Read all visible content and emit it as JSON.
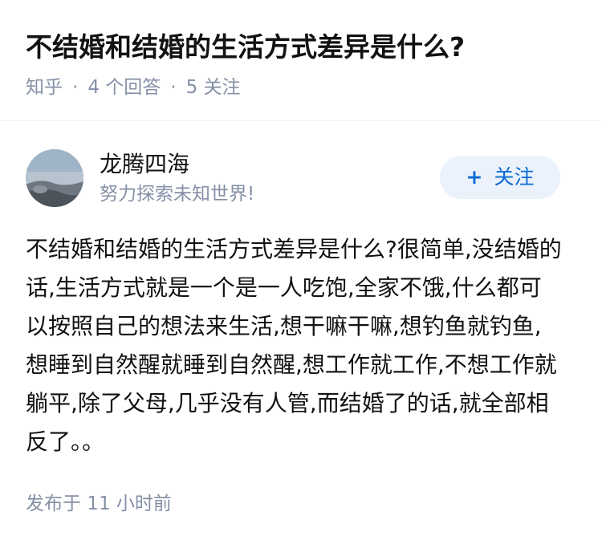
{
  "question": {
    "title": "不结婚和结婚的生活方式差异是什么?",
    "source": "知乎",
    "separator": "·",
    "answers_count": "4 个回答",
    "followers_count": "5 关注"
  },
  "author": {
    "name": "龙腾四海",
    "bio": "努力探索未知世界!",
    "avatar_icon": "landscape-avatar",
    "follow_plus": "+",
    "follow_label": "关注",
    "accent_color": "#0d6bd6"
  },
  "answer": {
    "content": "不结婚和结婚的生活方式差异是什么?很简单,没结婚的话,生活方式就是一个是一人吃饱,全家不饿,什么都可以按照自己的想法来生活,想干嘛干嘛,想钓鱼就钓鱼,想睡到自然醒就睡到自然醒,想工作就工作,不想工作就躺平,除了父母,几乎没有人管,而结婚了的话,就全部相反了。。",
    "published": "发布于  11 小时前"
  }
}
